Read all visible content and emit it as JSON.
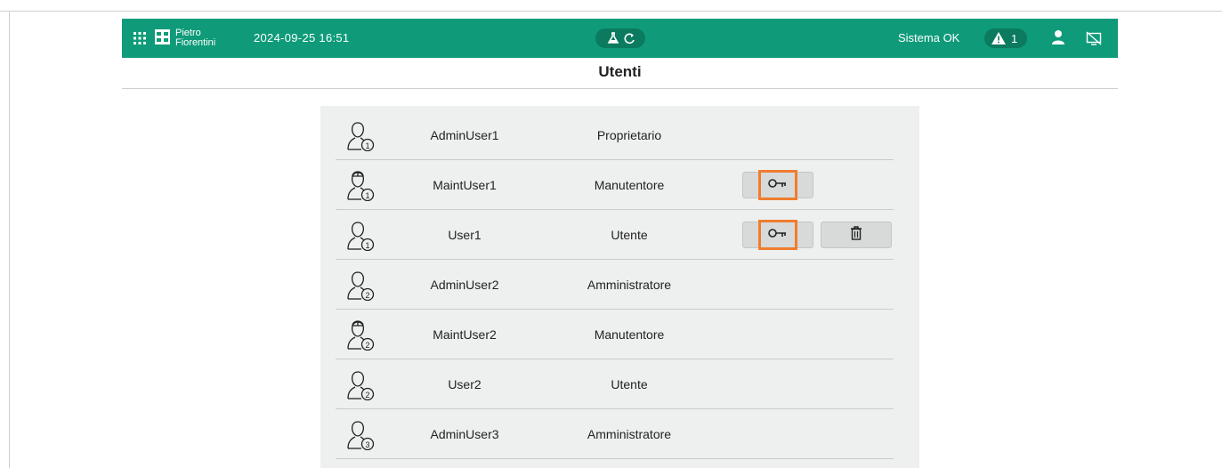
{
  "header": {
    "logo_text_line1": "Pietro",
    "logo_text_line2": "Fiorentini",
    "datetime": "2024-09-25 16:51",
    "status": "Sistema OK",
    "alarm_count": "1",
    "icons": [
      "grid-icon",
      "flask-icon",
      "refresh-icon",
      "warning-icon",
      "user-icon",
      "hmi-disconnected-icon"
    ],
    "colors": {
      "bar": "#0f9b79",
      "pill": "#0b7a5e"
    }
  },
  "page": {
    "title": "Utenti"
  },
  "users": [
    {
      "name": "AdminUser1",
      "role": "Proprietario",
      "level": "1",
      "type": "admin",
      "password_button": false,
      "delete_button": false
    },
    {
      "name": "MaintUser1",
      "role": "Manutentore",
      "level": "1",
      "type": "maintenance",
      "password_button": true,
      "delete_button": false
    },
    {
      "name": "User1",
      "role": "Utente",
      "level": "1",
      "type": "user",
      "password_button": true,
      "delete_button": true
    },
    {
      "name": "AdminUser2",
      "role": "Amministratore",
      "level": "2",
      "type": "admin",
      "password_button": false,
      "delete_button": false
    },
    {
      "name": "MaintUser2",
      "role": "Manutentore",
      "level": "2",
      "type": "maintenance",
      "password_button": false,
      "delete_button": false
    },
    {
      "name": "User2",
      "role": "Utente",
      "level": "2",
      "type": "user",
      "password_button": false,
      "delete_button": false
    },
    {
      "name": "AdminUser3",
      "role": "Amministratore",
      "level": "3",
      "type": "admin",
      "password_button": false,
      "delete_button": false
    }
  ],
  "highlight_color": "#ef7d2e"
}
